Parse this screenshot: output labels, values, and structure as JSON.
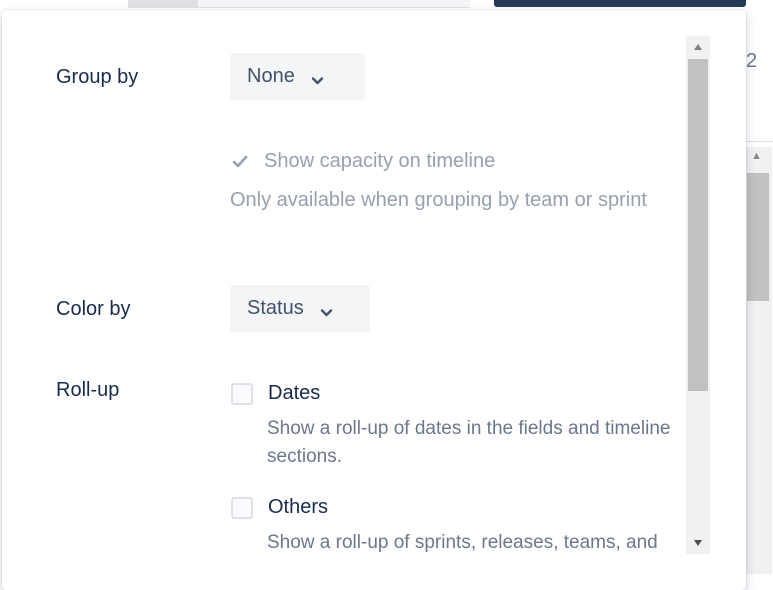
{
  "background": {
    "partial_digit": "2"
  },
  "panel": {
    "group_by": {
      "label": "Group by",
      "value": "None"
    },
    "capacity": {
      "label": "Show capacity on timeline",
      "checked": true,
      "disabled": true,
      "help": "Only available when grouping by team or sprint"
    },
    "color_by": {
      "label": "Color by",
      "value": "Status"
    },
    "roll_up": {
      "label": "Roll-up",
      "options": [
        {
          "label": "Dates",
          "checked": false,
          "help": "Show a roll-up of dates in the fields and timeline sections."
        },
        {
          "label": "Others",
          "checked": false,
          "help": "Show a roll-up of sprints, releases, teams, and"
        }
      ]
    }
  },
  "colors": {
    "text_primary": "#172b4d",
    "text_secondary": "#6b778c",
    "text_disabled": "#97a0af",
    "select_bg": "#f4f5f7",
    "header_button": "#253858"
  },
  "icons": {
    "select_chevron": "chevron-down-icon",
    "capacity_check": "checkmark-icon",
    "scroll_up": "triangle-up-icon",
    "scroll_down": "triangle-down-icon"
  }
}
